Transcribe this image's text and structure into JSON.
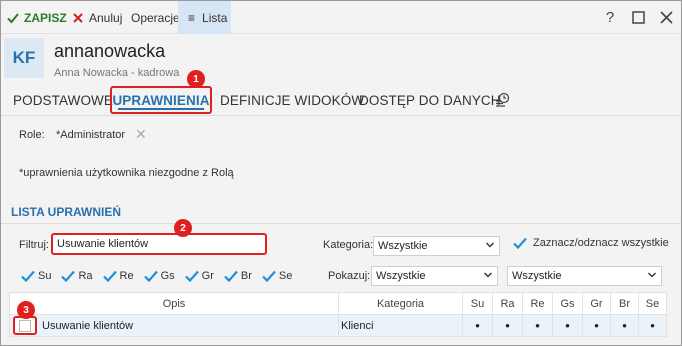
{
  "toolbar": {
    "save_label": "ZAPISZ",
    "cancel_label": "Anuluj",
    "operations_label": "Operacje",
    "list_label": "Lista",
    "help_label": "?",
    "maximize_label": "☐",
    "close_label": "✕"
  },
  "header": {
    "avatar_initials": "KF",
    "username": "annanowacka",
    "fullname": "Anna Nowacka - kadrowa"
  },
  "tabs": [
    {
      "label": "PODSTAWOWE"
    },
    {
      "label": "UPRAWNIENIA",
      "active": true
    },
    {
      "label": "DEFINICJE WIDOKÓW"
    },
    {
      "label": "DOSTĘP DO DANYCH"
    }
  ],
  "roles": {
    "label": "Role:",
    "value": "*Administrator"
  },
  "note": "*uprawnienia użytkownika niezgodne z Rolą",
  "section_title": "LISTA UPRAWNIEŃ",
  "filter": {
    "label": "Filtruj:",
    "value": "Usuwanie klientów"
  },
  "category": {
    "label": "Kategoria:",
    "value": "Wszystkie"
  },
  "select_all_label": "Zaznacz/odznacz wszystkie",
  "show": {
    "label": "Pokazuj:",
    "value1": "Wszystkie",
    "value2": "Wszystkie"
  },
  "permission_abbrs": [
    "Su",
    "Ra",
    "Re",
    "Gs",
    "Gr",
    "Br",
    "Se"
  ],
  "badges": [
    "1",
    "2",
    "3"
  ],
  "table": {
    "headers": {
      "opis": "Opis",
      "kategoria": "Kategoria",
      "cols": [
        "Su",
        "Ra",
        "Re",
        "Gs",
        "Gr",
        "Br",
        "Se"
      ]
    },
    "rows": [
      {
        "opis": "Usuwanie klientów",
        "kategoria": "Klienci",
        "marks": [
          "•",
          "•",
          "•",
          "•",
          "•",
          "•",
          "•"
        ]
      }
    ]
  },
  "colors": {
    "accent": "#2a6fb0",
    "highlight": "#e02020",
    "save_green": "#2c7a2c",
    "check_blue": "#1e8fd8"
  }
}
